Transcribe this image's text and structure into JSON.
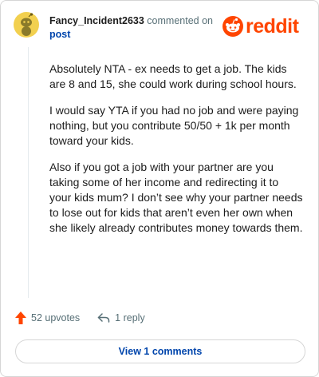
{
  "comment": {
    "username": "Fancy_Incident2633",
    "action_text": "commented on",
    "post_link": "post",
    "paragraphs": [
      "Absolutely NTA - ex needs to get a job. The kids are 8 and 15, she could work during school hours.",
      "I would say YTA if you had no job and were paying nothing, but you contribute 50/50 + 1k per month toward your kids.",
      "Also if you got a job with your partner are you taking some of her income and redirecting it to your kids mum? I don’t see why your partner needs to lose out for kids that aren’t even her own when she likely already contributes money towards them."
    ],
    "upvotes_label": "52 upvotes",
    "reply_label": "1 reply",
    "view_comments_label": "View 1 comments"
  },
  "branding": {
    "logo_text": "reddit",
    "brand_color": "#ff4500",
    "link_color": "#0045ac",
    "meta_color": "#576f76"
  },
  "icons": {
    "avatar": "snoo-avatar",
    "logo": "reddit-snoo-icon",
    "upvote": "upvote-arrow-icon",
    "reply": "reply-arrow-icon"
  }
}
